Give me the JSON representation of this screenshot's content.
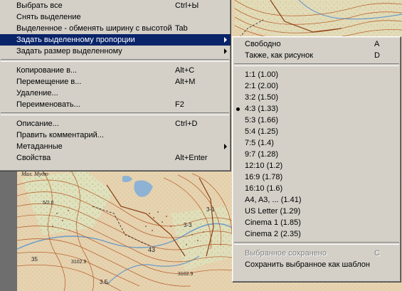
{
  "main_menu": {
    "items": [
      {
        "label": "Выбрать все",
        "shortcut": "Ctrl+Ы"
      },
      {
        "label": "Снять выделение",
        "shortcut": ""
      },
      {
        "label": "Выделенное - обменять ширину с высотой",
        "shortcut": "Tab"
      },
      {
        "label": "Задать выделенному пропорции",
        "shortcut": ""
      },
      {
        "label": "Задать размер выделенному",
        "shortcut": ""
      },
      {
        "label": "Копирование в...",
        "shortcut": "Alt+C"
      },
      {
        "label": "Перемещение в...",
        "shortcut": "Alt+M"
      },
      {
        "label": "Удаление...",
        "shortcut": ""
      },
      {
        "label": "Переименовать...",
        "shortcut": "F2"
      },
      {
        "label": "Описание...",
        "shortcut": "Ctrl+D"
      },
      {
        "label": "Править комментарий...",
        "shortcut": ""
      },
      {
        "label": "Метаданные",
        "shortcut": ""
      },
      {
        "label": "Свойства",
        "shortcut": "Alt+Enter"
      }
    ]
  },
  "sub_menu": {
    "items": [
      {
        "label": "Свободно",
        "shortcut": "A"
      },
      {
        "label": "Также, как рисунок",
        "shortcut": "D"
      },
      {
        "label": "1:1 (1.00)"
      },
      {
        "label": "2:1 (2.00)"
      },
      {
        "label": "3:2 (1.50)"
      },
      {
        "label": "4:3 (1.33)"
      },
      {
        "label": "5:3 (1.66)"
      },
      {
        "label": "5:4 (1.25)"
      },
      {
        "label": "7:5 (1.4)"
      },
      {
        "label": "9:7 (1.28)"
      },
      {
        "label": "12:10 (1.2)"
      },
      {
        "label": "16:9 (1.78)"
      },
      {
        "label": "16:10 (1.6)"
      },
      {
        "label": "A4, A3, ... (1.41)"
      },
      {
        "label": "US Letter (1.29)"
      },
      {
        "label": "Cinema 1 (1.85)"
      },
      {
        "label": "Cinema 2 (2.35)"
      },
      {
        "label": "Выбранное сохранено",
        "shortcut": "C"
      },
      {
        "label": "Сохранить выбранное как шаблон"
      }
    ],
    "selected": "4:3 (1.33)"
  },
  "map": {
    "labels": [
      "Мал. Мудю",
      "3-3",
      "3102.9",
      "3102.9",
      "43",
      "3.Б.",
      "3-1",
      "5/2.0",
      "35"
    ]
  },
  "colors": {
    "menu_bg": "#d4d0c8",
    "highlight": "#0a246a",
    "disabled_text": "#808080",
    "map_paper": "#e9d7b6",
    "contour": "#b85c2a",
    "water": "#7fa8cf"
  }
}
